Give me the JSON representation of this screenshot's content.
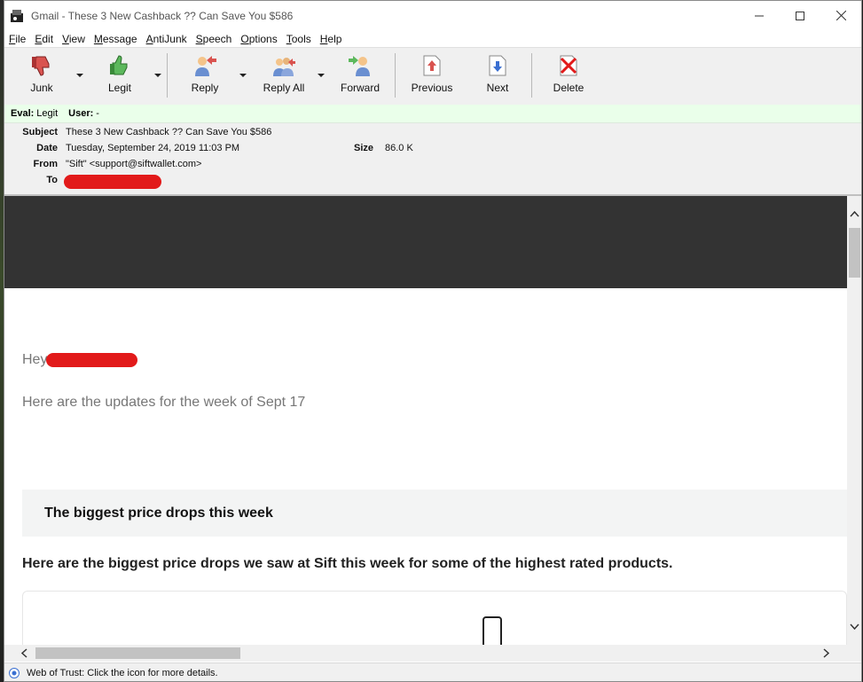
{
  "window": {
    "title": "Gmail - These 3 New Cashback ?? Can Save You $586"
  },
  "menu": [
    {
      "label": "File",
      "mnemonic": "F",
      "rest": "ile"
    },
    {
      "label": "Edit",
      "mnemonic": "E",
      "rest": "dit"
    },
    {
      "label": "View",
      "mnemonic": "V",
      "rest": "iew"
    },
    {
      "label": "Message",
      "mnemonic": "M",
      "rest": "essage"
    },
    {
      "label": "AntiJunk",
      "mnemonic": "A",
      "rest": "ntiJunk"
    },
    {
      "label": "Speech",
      "mnemonic": "S",
      "rest": "peech"
    },
    {
      "label": "Options",
      "mnemonic": "O",
      "rest": "ptions"
    },
    {
      "label": "Tools",
      "mnemonic": "T",
      "rest": "ools"
    },
    {
      "label": "Help",
      "mnemonic": "H",
      "rest": "elp"
    }
  ],
  "toolbar": {
    "junk": "Junk",
    "legit": "Legit",
    "reply": "Reply",
    "reply_all": "Reply All",
    "forward": "Forward",
    "previous": "Previous",
    "next": "Next",
    "delete": "Delete"
  },
  "eval": {
    "eval_label": "Eval:",
    "eval_value": "Legit",
    "user_label": "User:",
    "user_value": "-"
  },
  "headers": {
    "subject_label": "Subject",
    "subject": "These 3 New Cashback ?? Can Save You $586",
    "date_label": "Date",
    "date": "Tuesday, September 24, 2019 11:03 PM",
    "size_label": "Size",
    "size": "86.0 K",
    "from_label": "From",
    "from": "\"Sift\" <support@siftwallet.com>",
    "to_label": "To"
  },
  "body": {
    "greeting": "Hey",
    "updates": "Here are the updates for the week of Sept 17",
    "section_title": "The biggest price drops this week",
    "intro": "Here are the biggest price drops we saw at Sift this week for some of the highest rated products."
  },
  "status": {
    "text": "Web of Trust: Click the icon for more details."
  }
}
